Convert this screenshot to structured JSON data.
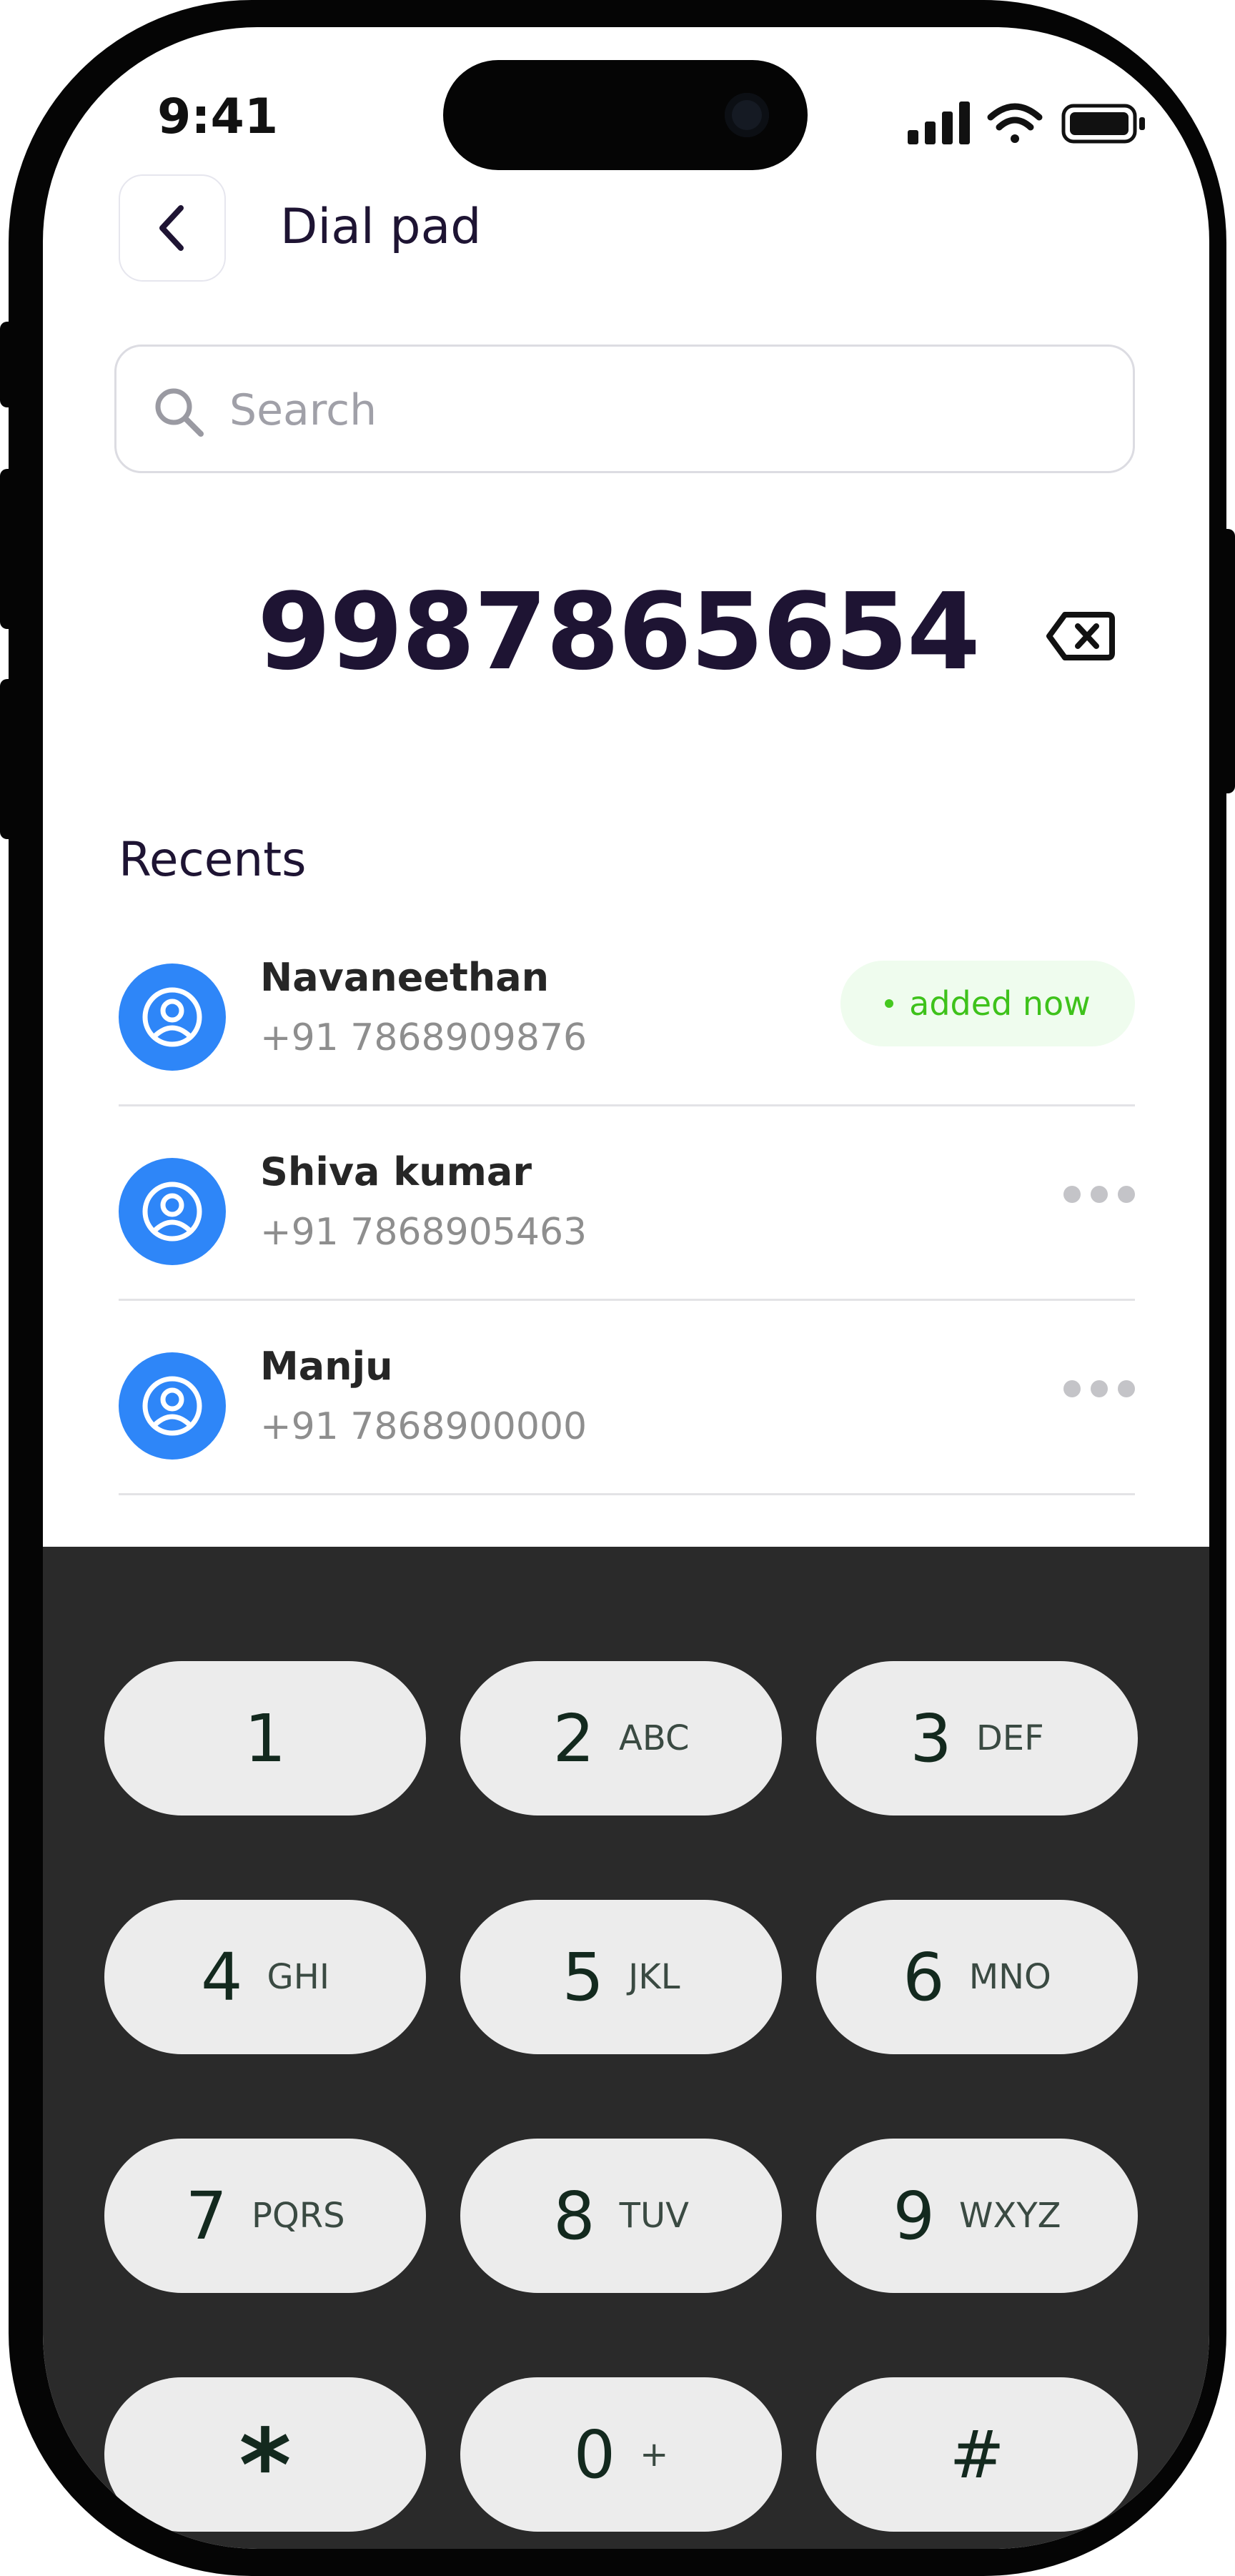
{
  "status_bar": {
    "time": "9:41"
  },
  "header": {
    "title": "Dial pad"
  },
  "search": {
    "placeholder": "Search"
  },
  "dialer": {
    "number": "9987865654"
  },
  "recents": {
    "title": "Recents",
    "items": [
      {
        "name": "Navaneethan",
        "phone": "+91 7868909876",
        "badge": "added now"
      },
      {
        "name": "Shiva kumar",
        "phone": "+91 7868905463"
      },
      {
        "name": "Manju",
        "phone": "+91 7868900000"
      }
    ]
  },
  "keypad": {
    "keys": [
      {
        "digit": "1",
        "letters": ""
      },
      {
        "digit": "2",
        "letters": "ABC"
      },
      {
        "digit": "3",
        "letters": "DEF"
      },
      {
        "digit": "4",
        "letters": "GHI"
      },
      {
        "digit": "5",
        "letters": "JKL"
      },
      {
        "digit": "6",
        "letters": "MNO"
      },
      {
        "digit": "7",
        "letters": "PQRS"
      },
      {
        "digit": "8",
        "letters": "TUV"
      },
      {
        "digit": "9",
        "letters": "WXYZ"
      },
      {
        "digit": "*",
        "letters": ""
      },
      {
        "digit": "0",
        "letters": "+"
      },
      {
        "digit": "#",
        "letters": ""
      }
    ]
  },
  "colors": {
    "accent_blue": "#2e86f8",
    "badge_green": "#3ec21b",
    "badge_bg": "#effcee",
    "title_dark": "#1e1433",
    "keypad_bg": "#2a2a2a",
    "key_bg": "#ececec"
  }
}
